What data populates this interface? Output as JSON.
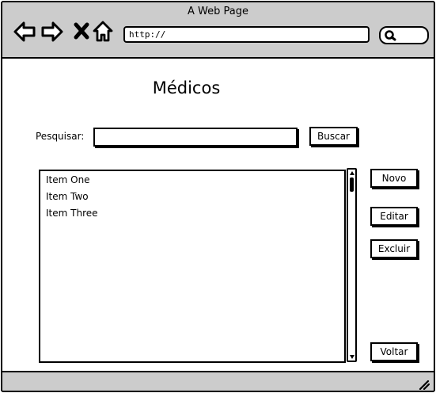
{
  "window": {
    "title": "A Web Page"
  },
  "browser": {
    "address": "http://",
    "icons": [
      "back-arrow-icon",
      "forward-arrow-icon",
      "close-x-icon",
      "home-icon",
      "search-icon"
    ]
  },
  "page": {
    "title": "Médicos",
    "search_label": "Pesquisar:",
    "search_value": "",
    "search_button": "Buscar"
  },
  "list": {
    "items": [
      "Item One",
      "Item Two",
      "Item Three"
    ]
  },
  "actions": {
    "new_label": "Novo",
    "edit_label": "Editar",
    "delete_label": "Excluir",
    "back_label": "Voltar"
  },
  "colors": {
    "chrome": "#cccccc",
    "ink": "#000000",
    "background": "#ffffff"
  }
}
